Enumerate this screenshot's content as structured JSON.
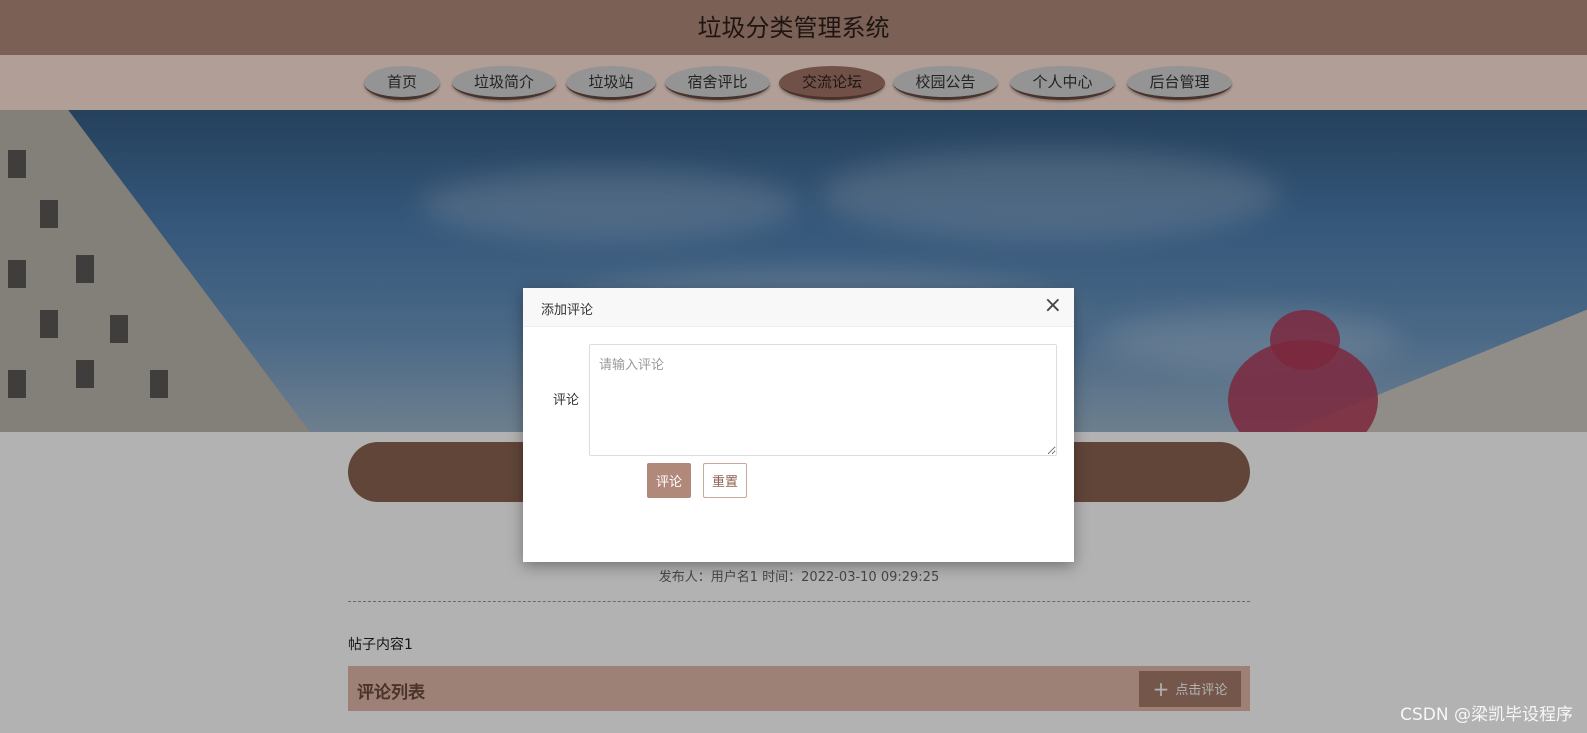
{
  "site": {
    "title": "垃圾分类管理系统"
  },
  "nav": {
    "items": [
      {
        "label": "首页"
      },
      {
        "label": "垃圾简介"
      },
      {
        "label": "垃圾站"
      },
      {
        "label": "宿舍评比"
      },
      {
        "label": "交流论坛",
        "active": true
      },
      {
        "label": "校园公告"
      },
      {
        "label": "个人中心"
      },
      {
        "label": "后台管理"
      }
    ]
  },
  "post": {
    "meta": "发布人：用户名1 时间：2022-03-10 09:29:25",
    "content": "帖子内容1"
  },
  "comments": {
    "header": "评论列表",
    "add_button": "点击评论"
  },
  "modal": {
    "title": "添加评论",
    "close_icon": "×",
    "field_label": "评论",
    "placeholder": "请输入评论",
    "submit_label": "评论",
    "reset_label": "重置"
  },
  "watermark": "CSDN @梁凯毕设程序",
  "colors": {
    "header_bg": "#b08a7b",
    "nav_bg": "#fde2d8",
    "accent": "#8c6352",
    "button": "#b0897a"
  }
}
